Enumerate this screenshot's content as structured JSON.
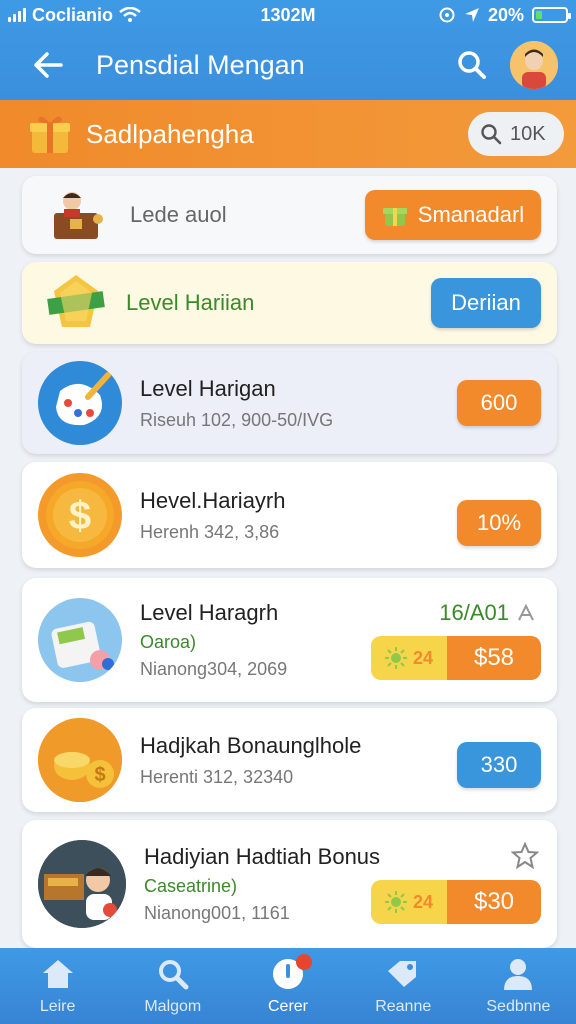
{
  "status_bar": {
    "carrier": "Coclianio",
    "time": "1302M",
    "battery": "20%",
    "battery_level": 0.2
  },
  "header": {
    "title": "Pensdial Mengan"
  },
  "banner": {
    "title": "Sadlpahengha",
    "pill_label": "10K"
  },
  "cards": [
    {
      "title": "Lede auol",
      "button": "Smanadarl"
    },
    {
      "title": "Level Hariian",
      "button": "Deriian"
    },
    {
      "title": "Level Harigan",
      "subtitle": "Riseuh 102, 900-50/IVG",
      "button": "600"
    },
    {
      "title": "Hevel.Hariayrh",
      "subtitle": "Herenh 342, 3,86",
      "button": "10%"
    },
    {
      "title": "Level Haragrh",
      "subtitle_color": "Oaroa)",
      "subtitle": "Nianong304, 2069",
      "top_right": "16/A01",
      "combo_left": "24",
      "combo_right": "$58"
    },
    {
      "title": "Hadjkah Bonaunglhole",
      "subtitle": "Herenti 312, 32340",
      "button": "330"
    },
    {
      "title": "Hadiyian Hadtiah Bonus",
      "subtitle_color": "Caseatrine)",
      "subtitle": "Nianong001, 1161",
      "combo_left": "24",
      "combo_right": "$30"
    }
  ],
  "nav": [
    {
      "label": "Leire",
      "icon": "home-icon"
    },
    {
      "label": "Malgom",
      "icon": "search-icon"
    },
    {
      "label": "Cerer",
      "icon": "power-icon"
    },
    {
      "label": "Reanne",
      "icon": "tag-icon"
    },
    {
      "label": "Sedbnne",
      "icon": "profile-icon"
    }
  ],
  "colors": {
    "primary": "#3b8fdd",
    "accent": "#f28a2c",
    "blue_button": "#3a96dc",
    "green_text": "#3a8a2a"
  }
}
